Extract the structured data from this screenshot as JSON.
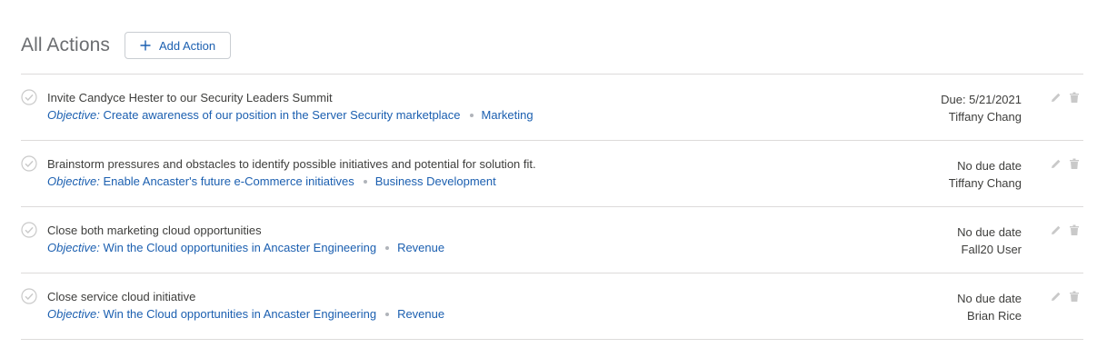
{
  "header": {
    "title": "All Actions",
    "add_button_label": "Add Action"
  },
  "actions": [
    {
      "title": "Invite Candyce Hester to our Security Leaders Summit",
      "objective_label": "Objective:",
      "objective": "Create awareness of our position in the Server Security marketplace",
      "category": "Marketing",
      "due": "Due: 5/21/2021",
      "owner": "Tiffany Chang"
    },
    {
      "title": "Brainstorm pressures and obstacles to identify possible initiatives and potential for solution fit.",
      "objective_label": "Objective:",
      "objective": "Enable Ancaster's future e-Commerce initiatives",
      "category": "Business Development",
      "due": "No due date",
      "owner": "Tiffany Chang"
    },
    {
      "title": "Close both marketing cloud opportunities",
      "objective_label": "Objective:",
      "objective": "Win the Cloud opportunities in Ancaster Engineering",
      "category": "Revenue",
      "due": "No due date",
      "owner": "Fall20 User"
    },
    {
      "title": "Close service cloud initiative",
      "objective_label": "Objective:",
      "objective": "Win the Cloud opportunities in Ancaster Engineering",
      "category": "Revenue",
      "due": "No due date",
      "owner": "Brian Rice"
    }
  ],
  "icons": {
    "complete": "check-circle-icon",
    "add": "plus-icon",
    "edit": "pencil-icon",
    "delete": "trash-icon"
  },
  "colors": {
    "link": "#1b5fb0",
    "text": "#3e3e3c",
    "title": "#6b6d70",
    "divider": "#dddbda",
    "icon_muted": "#c9c9c9"
  }
}
